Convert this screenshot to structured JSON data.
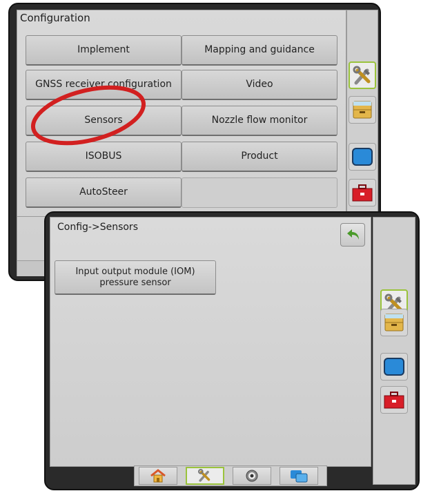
{
  "back_panel": {
    "title": "Configuration",
    "buttons": [
      {
        "label": "Implement"
      },
      {
        "label": "Mapping and guidance"
      },
      {
        "label": "GNSS receiver configuration"
      },
      {
        "label": "Video"
      },
      {
        "label": "Sensors"
      },
      {
        "label": "Nozzle flow monitor"
      },
      {
        "label": "ISOBUS"
      },
      {
        "label": "Product"
      },
      {
        "label": "AutoSteer"
      }
    ],
    "side_tabs": [
      {
        "icon": "tools-icon",
        "active": true
      },
      {
        "icon": "data-management-icon",
        "active": false
      },
      {
        "icon": "console-icon",
        "active": false
      },
      {
        "icon": "toolbox-icon",
        "active": false
      }
    ]
  },
  "front_panel": {
    "title": "Config->Sensors",
    "sensor_button": "Input output module (IOM) pressure sensor",
    "side_tabs": [
      {
        "icon": "tools-icon",
        "active": true
      },
      {
        "icon": "data-management-icon",
        "active": false
      },
      {
        "icon": "console-icon",
        "active": false
      },
      {
        "icon": "toolbox-icon",
        "active": false
      }
    ],
    "nav_bar": [
      {
        "icon": "home-icon",
        "active": false
      },
      {
        "icon": "tools-icon",
        "active": true
      },
      {
        "icon": "guidance-icon",
        "active": false
      },
      {
        "icon": "full-screen-icon",
        "active": false
      }
    ]
  },
  "colors": {
    "active_highlight": "#9ac33c",
    "annotation_circle": "#d22020",
    "data_tab": "#e3b64a",
    "console_tab": "#2a8ad8",
    "toolbox_tab": "#d81e28"
  }
}
